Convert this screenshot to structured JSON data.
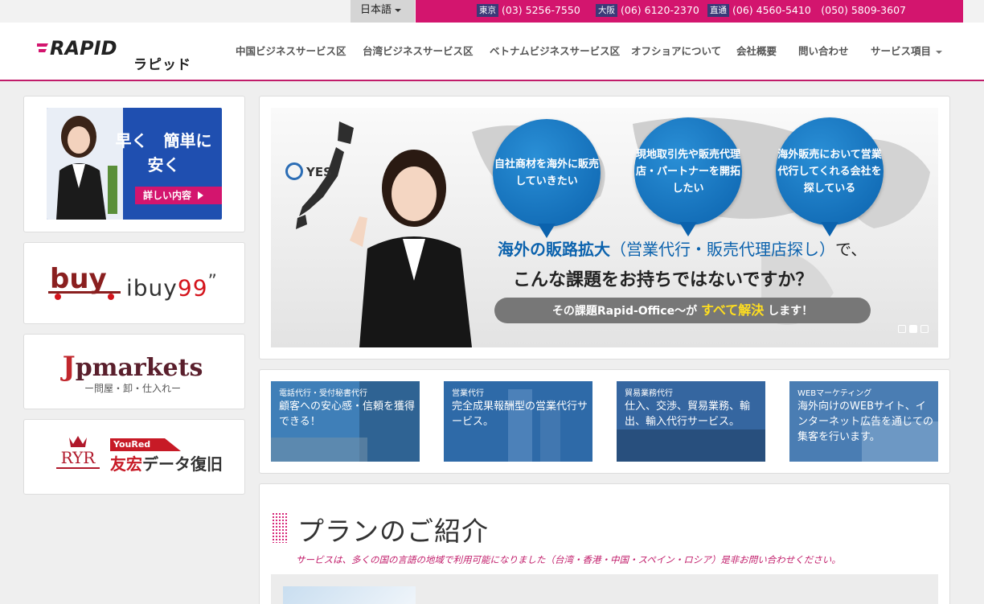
{
  "topbar": {
    "language": "日本語",
    "phones": [
      {
        "city": "東京",
        "number": "(03) 5256-7550"
      },
      {
        "city": "大阪",
        "number": "(06) 6120-2370"
      },
      {
        "city": "直通",
        "number": "(06) 4560-5410　(050) 5809-3607"
      }
    ]
  },
  "header": {
    "logo_text": "RAPID",
    "logo_kana": "ラピッド",
    "nav": [
      "中国ビジネスサービス区",
      "台湾ビジネスサービス区",
      "ベトナムビジネスサービス区",
      "オフショアについて",
      "会社概要",
      "問い合わせ",
      "サービス項目"
    ]
  },
  "sidebar": {
    "promo": {
      "headline_1": "早く　簡単に",
      "headline_2": "安く",
      "button": "詳しい内容"
    },
    "ibuy": {
      "logo": "buy",
      "name_prefix": "ibuy",
      "name_suffix": "99"
    },
    "jpmarkets": {
      "name_first": "J",
      "name_rest": "pmarkets",
      "sub": "ー問屋・卸・仕入れー"
    },
    "youred": {
      "monogram": "RYR",
      "tag": "YouRed",
      "name_red": "友宏",
      "name_rest": "データ復旧"
    }
  },
  "slider": {
    "brand": "YES",
    "bubbles": [
      "自社商材を海外に販売していきたい",
      "現地取引先や販売代理店・パートナーを開拓したい",
      "海外販売において営業代行してくれる会社を探している"
    ],
    "line1_bold": "海外の販路拡大",
    "line1_paren": "（営業代行・販売代理店探し）",
    "line1_end": "で、",
    "line2": "こんな課題をお持ちではないですか？",
    "pill_prefix": "その課題Rapid-Office～が",
    "pill_highlight": "すべて解決",
    "pill_suffix": "します！"
  },
  "services": [
    {
      "category": "電話代行・受付秘書代行",
      "desc": "顧客への安心感・信頼を獲得できる！",
      "color": "#3f7fb8"
    },
    {
      "category": "営業代行",
      "desc": "完全成果報酬型の営業代行サービス。",
      "color": "#2e6aa8"
    },
    {
      "category": "貿易業務代行",
      "desc": "仕入、交渉、貿易業務、輸出、輸入代行サービス。",
      "color": "#3566a0"
    },
    {
      "category": "WEBマーケティング",
      "desc": "海外向けのWEBサイト、インターネット広告を通じての集客を行います。",
      "color": "#4a7db3"
    }
  ],
  "plan": {
    "title": "プランのご紹介",
    "subtitle": "サービスは、多くの国の言語の地域で利用可能になりました（台湾・香港・中国・スペイン・ロシア）是非お問い合わせください。"
  }
}
